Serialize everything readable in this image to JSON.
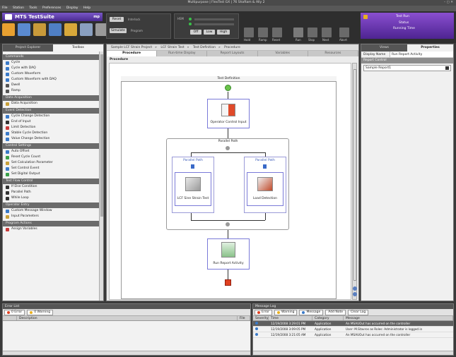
{
  "window": {
    "title": "Multipurpose | FlexTest GX | 76 Shaftam & Ally 2"
  },
  "menu": [
    "File",
    "Station",
    "Tools",
    "Preferences",
    "Display",
    "Help"
  ],
  "app": {
    "name": "MTS TestSuite",
    "version": "mp"
  },
  "station_controls": {
    "reset_label": "Reset",
    "interlock_label": "Interlock",
    "simulate_label": "Simulate",
    "program_label": "Program",
    "off_label": "Off",
    "low_label": "Low",
    "high_label": "High",
    "hpu_label": "HSM",
    "toolbar_labels": [
      "Hold",
      "Ramp",
      "Reset",
      "Run",
      "Stop",
      "Next",
      "Abort"
    ]
  },
  "status_card": {
    "title": "Test Run",
    "line1": "Status",
    "line2": "Running Time"
  },
  "left_panel": {
    "tabs": [
      "Project Explorer",
      "Toolbox"
    ],
    "active_tab": 1,
    "categories": [
      {
        "name": "Commands",
        "items": [
          "Cycle",
          "Cycle with DAQ",
          "Custom Waveform",
          "Custom Waveform with DAQ",
          "Dwell",
          "Ramp"
        ]
      },
      {
        "name": "Data Acquisition",
        "items": [
          "Data Acquisition"
        ]
      },
      {
        "name": "Event Detection",
        "items": [
          "Cycle Change Detection",
          "End of Input",
          "Limit Detection",
          "Stable Cycle Detection",
          "Value Change Detection"
        ]
      },
      {
        "name": "Control Settings",
        "items": [
          "Auto Offset",
          "Reset Cycle Count",
          "Set Calculation Parameter",
          "Set Control Event",
          "Set Digital Output"
        ]
      },
      {
        "name": "Test Flow Control",
        "items": [
          "If Else Condition",
          "Parallel Path",
          "While Loop"
        ]
      },
      {
        "name": "Operator Entry",
        "items": [
          "Custom Message Window",
          "Input Parameters"
        ]
      },
      {
        "name": "Program Actions",
        "items": [
          "Assign Variables"
        ]
      }
    ]
  },
  "main": {
    "breadcrumb": [
      "Sample LCF Strain Project",
      "LCF Strain Test",
      "Test Definition",
      "Procedure"
    ],
    "tabs": [
      "Procedure",
      "Run-time Display",
      "Report Layouts",
      "Variables",
      "Resources"
    ],
    "active_tab": 0,
    "procedure_label": "Procedure",
    "flow": {
      "header": "Test Definition",
      "operator_node": "Operator Control Input",
      "parallel_group": "Parallel Path",
      "path_left": "Parallel Path",
      "path_right": "Parallel Path",
      "left_node": "LCF Sine Strain Test",
      "right_node": "Load Detection",
      "report_node": "Run Report Activity"
    }
  },
  "right_panel": {
    "tabs": [
      "Views",
      "Properties"
    ],
    "active_tab": 1,
    "display_name_key": "Display Name",
    "display_name_value": "Run Report Activity",
    "section": "Report Control",
    "report_value": "Sample Report1"
  },
  "error_list": {
    "title": "Error List",
    "errors_label": "0 Error",
    "warnings_label": "0 Warning",
    "columns": [
      "Description",
      "File"
    ]
  },
  "message_log": {
    "title": "Message Log",
    "error_label": "Error",
    "warning_label": "Warning",
    "message_label": "Message",
    "add_note_label": "Add Note",
    "clear_log_label": "Clear Log",
    "columns": [
      "Severity",
      "Time",
      "Category",
      "Message"
    ],
    "rows": [
      {
        "time": "12/19/2008 3:29:01 PM",
        "category": "Application",
        "message": "An MSAUOut has occurred on the controller",
        "selected": true
      },
      {
        "time": "12/19/2008 3:09:05 PM",
        "category": "Application",
        "message": "User: M.Stavros as Roles: Administrator is logged in",
        "selected": false
      },
      {
        "time": "12/19/2008 3:21:05 AM",
        "category": "Application",
        "message": "An MSAUOut has occurred on the controller",
        "selected": false
      }
    ]
  },
  "colors": {
    "brand_purple": "#6a3fb8",
    "status_green": "#39c24a",
    "flow_border": "#7a7ad8",
    "stop_red": "#e04020"
  }
}
